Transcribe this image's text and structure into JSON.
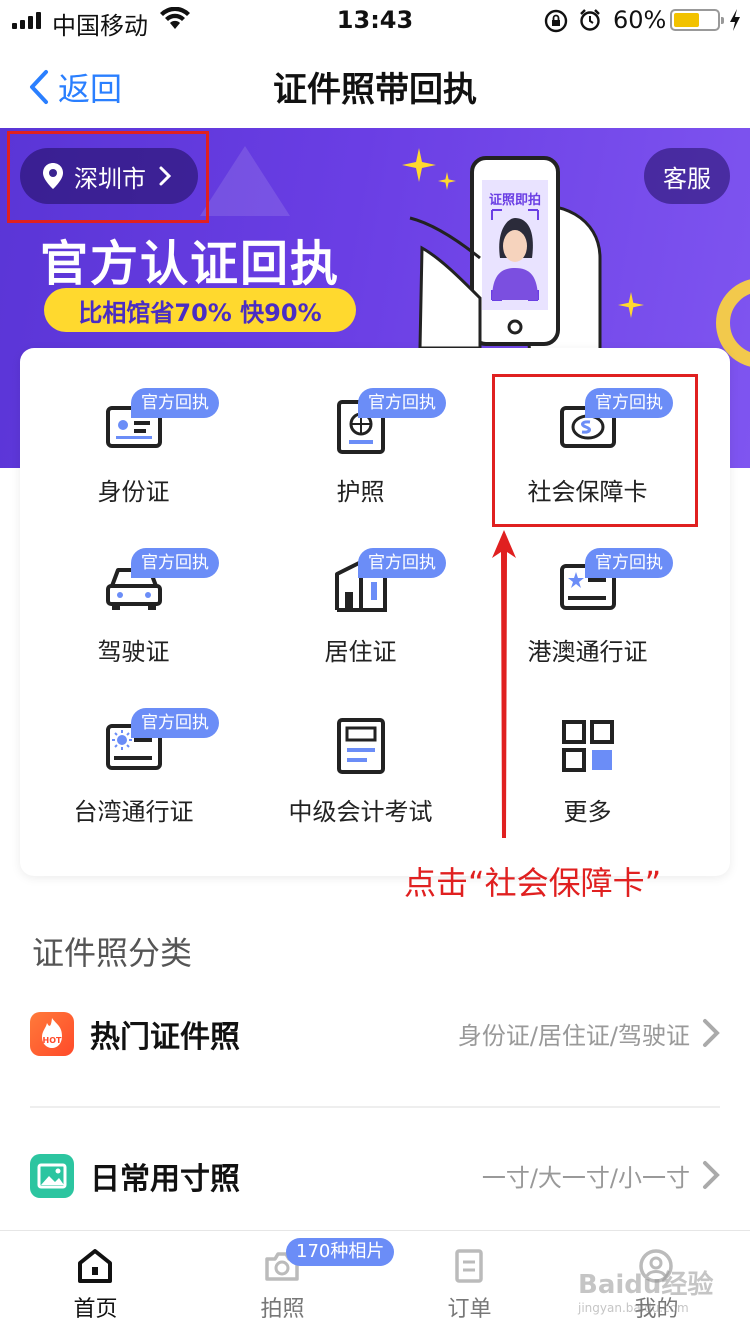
{
  "status_bar": {
    "carrier": "中国移动",
    "time": "13:43",
    "battery_percent": "60%",
    "battery_level": 0.6,
    "icons": [
      "signal-icon",
      "wifi-icon",
      "orientation-lock-icon",
      "alarm-icon",
      "battery-icon",
      "charging-icon"
    ]
  },
  "nav": {
    "back_label": "返回",
    "title": "证件照带回执"
  },
  "banner": {
    "city": "深圳市",
    "customer_service": "客服",
    "headline": "官方认证回执",
    "subline": "比相馆省70% 快90%",
    "phone_caption": "证照即拍"
  },
  "services": [
    {
      "label": "身份证",
      "tag": "官方回执",
      "icon": "id-card-icon"
    },
    {
      "label": "护照",
      "tag": "官方回执",
      "icon": "passport-icon"
    },
    {
      "label": "社会保障卡",
      "tag": "官方回执",
      "icon": "social-security-card-icon"
    },
    {
      "label": "驾驶证",
      "tag": "官方回执",
      "icon": "car-icon"
    },
    {
      "label": "居住证",
      "tag": "官方回执",
      "icon": "residence-permit-icon"
    },
    {
      "label": "港澳通行证",
      "tag": "官方回执",
      "icon": "hk-macau-permit-icon"
    },
    {
      "label": "台湾通行证",
      "tag": "官方回执",
      "icon": "taiwan-permit-icon"
    },
    {
      "label": "中级会计考试",
      "tag": "",
      "icon": "document-icon"
    },
    {
      "label": "更多",
      "tag": "",
      "icon": "grid-more-icon"
    }
  ],
  "annotation": {
    "text": "点击“社会保障卡”",
    "color": "#e02020"
  },
  "categories": {
    "title": "证件照分类",
    "items": [
      {
        "title": "热门证件照",
        "hint": "身份证/居住证/驾驶证",
        "icon": "hot-icon",
        "icon_text": "HOT"
      },
      {
        "title": "日常用寸照",
        "hint": "一寸/大一寸/小一寸",
        "icon": "image-icon"
      }
    ]
  },
  "tabs": [
    {
      "label": "首页",
      "icon": "home-icon",
      "active": true
    },
    {
      "label": "拍照",
      "icon": "camera-icon",
      "active": false
    },
    {
      "label": "订单",
      "icon": "order-icon",
      "active": false
    },
    {
      "label": "我的",
      "icon": "profile-icon",
      "active": false
    }
  ],
  "tab_badge": "170种相片",
  "watermark": {
    "text": "Baidu经验",
    "sub": "jingyan.baidu.com"
  },
  "colors": {
    "accent": "#2a7fff",
    "banner": "#6a3ee4",
    "tag": "#6b8df7",
    "highlight": "#ffd92e"
  }
}
